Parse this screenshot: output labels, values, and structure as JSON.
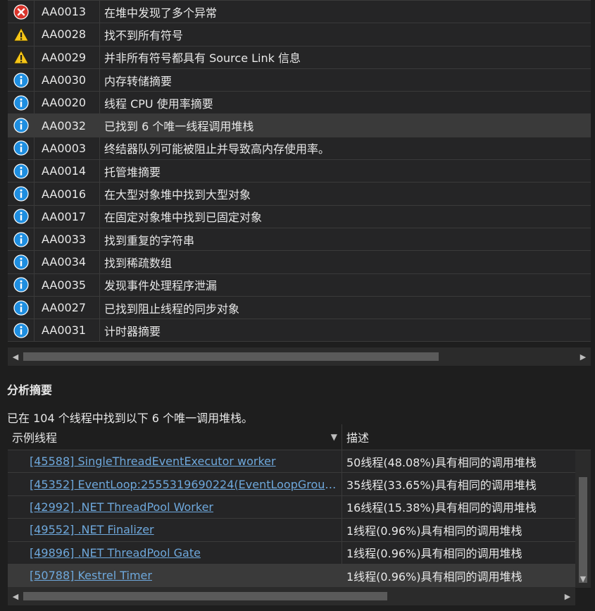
{
  "diagnostics": [
    {
      "severity": "error",
      "code": "AA0013",
      "title": "在堆中发现了多个异常"
    },
    {
      "severity": "warning",
      "code": "AA0028",
      "title": "找不到所有符号"
    },
    {
      "severity": "warning",
      "code": "AA0029",
      "title": "并非所有符号都具有 Source Link 信息"
    },
    {
      "severity": "info",
      "code": "AA0030",
      "title": "内存转储摘要"
    },
    {
      "severity": "info",
      "code": "AA0020",
      "title": "线程 CPU 使用率摘要"
    },
    {
      "severity": "info",
      "code": "AA0032",
      "title": "已找到 6 个唯一线程调用堆栈"
    },
    {
      "severity": "info",
      "code": "AA0003",
      "title": "终结器队列可能被阻止并导致高内存使用率。"
    },
    {
      "severity": "info",
      "code": "AA0014",
      "title": "托管堆摘要"
    },
    {
      "severity": "info",
      "code": "AA0016",
      "title": "在大型对象堆中找到大型对象"
    },
    {
      "severity": "info",
      "code": "AA0017",
      "title": "在固定对象堆中找到已固定对象"
    },
    {
      "severity": "info",
      "code": "AA0033",
      "title": "找到重复的字符串"
    },
    {
      "severity": "info",
      "code": "AA0034",
      "title": "找到稀疏数组"
    },
    {
      "severity": "info",
      "code": "AA0035",
      "title": "发现事件处理程序泄漏"
    },
    {
      "severity": "info",
      "code": "AA0027",
      "title": "已找到阻止线程的同步对象"
    },
    {
      "severity": "info",
      "code": "AA0031",
      "title": "计时器摘要"
    }
  ],
  "summary": {
    "title": "分析摘要",
    "description": "已在 104 个线程中找到以下 6 个唯一调用堆栈。",
    "columns": [
      "示例线程",
      "描述"
    ],
    "rows": [
      {
        "thread": "[45588] SingleThreadEventExecutor worker",
        "desc": "50线程(48.08%)具有相同的调用堆栈"
      },
      {
        "thread": "[45352] EventLoop:2555319690224(EventLoopGroup-…",
        "desc": "35线程(33.65%)具有相同的调用堆栈"
      },
      {
        "thread": "[42992] .NET ThreadPool Worker",
        "desc": "16线程(15.38%)具有相同的调用堆栈"
      },
      {
        "thread": "[49552] .NET Finalizer",
        "desc": "1线程(0.96%)具有相同的调用堆栈"
      },
      {
        "thread": "[49896] .NET ThreadPool Gate",
        "desc": "1线程(0.96%)具有相同的调用堆栈"
      },
      {
        "thread": "[50788] Kestrel Timer",
        "desc": "1线程(0.96%)具有相同的调用堆栈"
      }
    ]
  },
  "colors": {
    "link": "#6ea8dc",
    "info": "#1e8ee0",
    "warning": "#f5c518",
    "error": "#d9342b"
  },
  "selected": {
    "diagnostic_row": 5,
    "summary_row": 5
  }
}
